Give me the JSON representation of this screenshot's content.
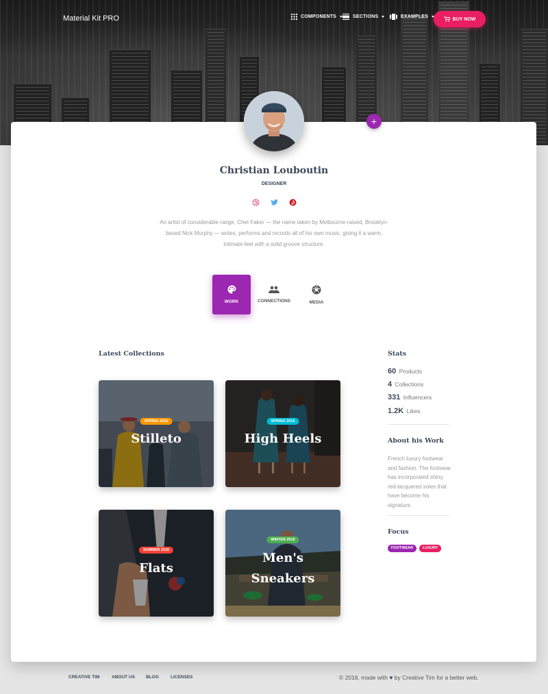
{
  "navbar": {
    "brand": "Material Kit PRO",
    "items": [
      {
        "label": "COMPONENTS",
        "icon": "apps-grid-icon"
      },
      {
        "label": "SECTIONS",
        "icon": "view-day-icon"
      },
      {
        "label": "EXAMPLES",
        "icon": "view-carousel-icon"
      }
    ],
    "buy_label": "BUY NOW"
  },
  "profile": {
    "name": "Christian Louboutin",
    "role": "DESIGNER",
    "socials": [
      "dribbble-icon",
      "twitter-icon",
      "pinterest-icon"
    ],
    "bio": "An artist of considerable range, Chet Faker — the name taken by Melbourne-raised, Brooklyn-based Nick Murphy — writes, performs and records all of his own music, giving it a warm, intimate feel with a solid groove structure."
  },
  "tabs": [
    {
      "label": "WORK",
      "icon": "palette-icon",
      "active": true
    },
    {
      "label": "CONNECTIONS",
      "icon": "people-icon",
      "active": false
    },
    {
      "label": "MEDIA",
      "icon": "camera-shutter-icon",
      "active": false
    }
  ],
  "collections": {
    "title": "Latest Collections",
    "items": [
      {
        "title": "Stilleto",
        "badge": "SPRING 2016",
        "badge_color": "#ff9800"
      },
      {
        "title": "High Heels",
        "badge": "SPRING 2016",
        "badge_color": "#00bcd4"
      },
      {
        "title": "Flats",
        "badge": "SUMMER 2016",
        "badge_color": "#f44336"
      },
      {
        "title": "Men's Sneakers",
        "badge": "WINTER 2015",
        "badge_color": "#4caf50"
      }
    ]
  },
  "stats": {
    "title": "Stats",
    "items": [
      {
        "value": "60",
        "label": "Products"
      },
      {
        "value": "4",
        "label": "Collections"
      },
      {
        "value": "331",
        "label": "Influencers"
      },
      {
        "value": "1.2K",
        "label": "Likes"
      }
    ]
  },
  "about": {
    "title": "About his Work",
    "text": "French luxury footwear and fashion. The footwear has incorporated shiny, red-lacquered soles that have become his signature."
  },
  "focus": {
    "title": "Focus",
    "tags": [
      {
        "label": "FOOTWEAR",
        "color": "#9c27b0"
      },
      {
        "label": "LUXURY",
        "color": "#e91e63"
      }
    ]
  },
  "footer": {
    "links": [
      "CREATIVE TIM",
      "ABOUT US",
      "BLOG",
      "LICENSES"
    ],
    "copyright_prefix": "© 2018, made with",
    "copyright_suffix": "by Creative Tim for a better web."
  },
  "colors": {
    "primary": "#9c27b0",
    "rose": "#e91e63"
  }
}
